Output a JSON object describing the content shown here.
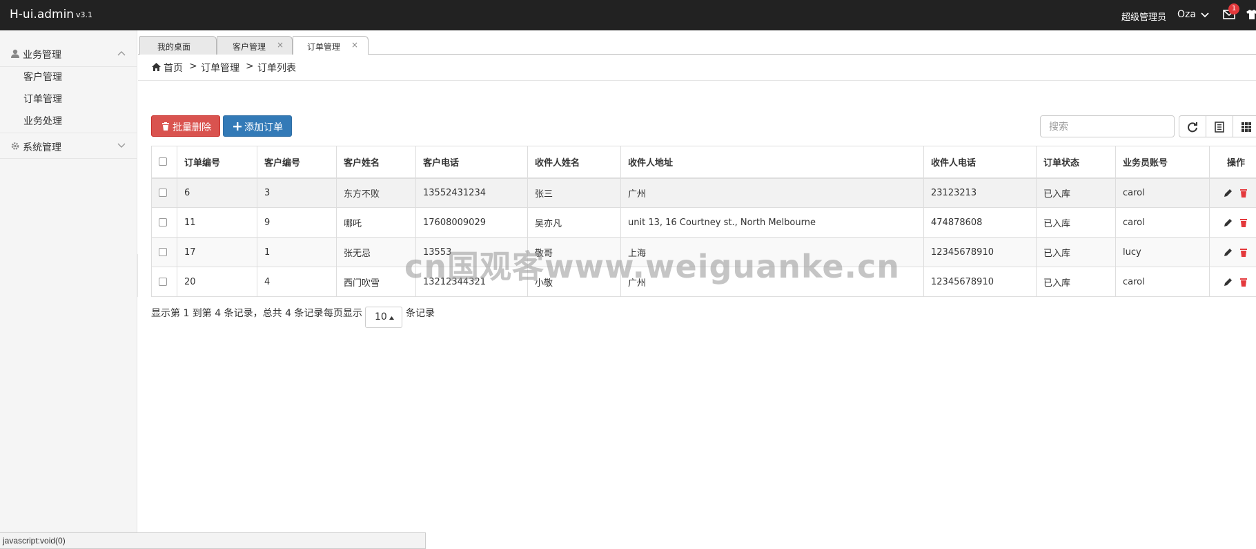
{
  "header": {
    "brand": "H-ui.admin",
    "version": "v3.1",
    "user_role": "超级管理员",
    "user_name": "Oza",
    "mail_badge": "1"
  },
  "sidebar": {
    "groups": [
      {
        "label": "业务管理",
        "icon": "user-icon",
        "expanded": true,
        "items": [
          {
            "label": "客户管理"
          },
          {
            "label": "订单管理"
          },
          {
            "label": "业务处理"
          }
        ]
      },
      {
        "label": "系统管理",
        "icon": "gear-icon",
        "expanded": false,
        "items": []
      }
    ]
  },
  "tabs": [
    {
      "label": "我的桌面",
      "closable": false,
      "active": false
    },
    {
      "label": "客户管理",
      "closable": true,
      "active": false
    },
    {
      "label": "订单管理",
      "closable": true,
      "active": true
    }
  ],
  "tab_close_glyph": "×",
  "breadcrumb": {
    "home": "首页",
    "separator": ">",
    "items": [
      "订单管理",
      "订单列表"
    ]
  },
  "toolbar": {
    "batch_delete_label": "批量删除",
    "add_order_label": "添加订单",
    "search_placeholder": "搜索"
  },
  "table": {
    "columns": [
      "订单编号",
      "客户编号",
      "客户姓名",
      "客户电话",
      "收件人姓名",
      "收件人地址",
      "收件人电话",
      "订单状态",
      "业务员账号",
      "操作"
    ],
    "rows": [
      {
        "order_id": "6",
        "customer_id": "3",
        "customer_name": "东方不败",
        "customer_phone": "13552431234",
        "receiver_name": "张三",
        "receiver_address": "广州",
        "receiver_phone": "23123213",
        "status": "已入库",
        "salesman": "carol"
      },
      {
        "order_id": "11",
        "customer_id": "9",
        "customer_name": "哪吒",
        "customer_phone": "17608009029",
        "receiver_name": "吴亦凡",
        "receiver_address": "unit 13, 16 Courtney st., North Melbourne",
        "receiver_phone": "474878608",
        "status": "已入库",
        "salesman": "carol"
      },
      {
        "order_id": "17",
        "customer_id": "1",
        "customer_name": "张无忌",
        "customer_phone": "13553",
        "receiver_name": "敬哥",
        "receiver_address": "上海",
        "receiver_phone": "12345678910",
        "status": "已入库",
        "salesman": "lucy"
      },
      {
        "order_id": "20",
        "customer_id": "4",
        "customer_name": "西门吹雪",
        "customer_phone": "13212344321",
        "receiver_name": "小敬",
        "receiver_address": "广州",
        "receiver_phone": "12345678910",
        "status": "已入库",
        "salesman": "carol"
      }
    ]
  },
  "pagination": {
    "info": "显示第 1 到第 4 条记录，总共 4 条记录",
    "page_size_label": "每页显示",
    "page_size": "10",
    "suffix": "条记录"
  },
  "status_bar": "javascript:void(0)",
  "watermark": "cn国观客www.weiguanke.cn",
  "colors": {
    "topbar": "#222222",
    "danger": "#d9534f",
    "primary": "#337ab7",
    "delete_icon": "#e4393c"
  }
}
